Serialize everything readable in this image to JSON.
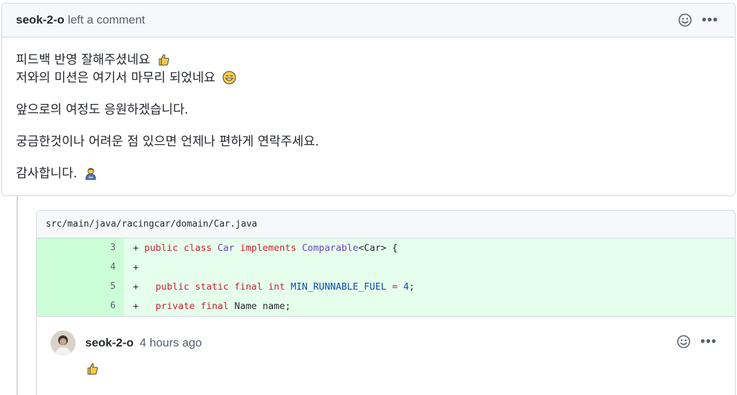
{
  "comment": {
    "author": "seok-2-o",
    "action": "left a comment",
    "paragraphs": [
      {
        "lines": [
          "피드백 반영 잘해주셨네요",
          "저와의 미션은 여기서 마무리 되었네요"
        ],
        "emojis": [
          "thumbs-up",
          "grinning-face"
        ]
      },
      {
        "text": "앞으로의 여정도 응원하겠습니다."
      },
      {
        "text": "궁금한것이나 어려운 점 있으면 언제나 편하게 연락주세요."
      },
      {
        "text": "감사합니다.",
        "emoji": "person-bowing"
      }
    ]
  },
  "thread": {
    "file_path": "src/main/java/racingcar/domain/Car.java",
    "diff": [
      {
        "line": "3",
        "code": "+ public class Car implements Comparable<Car> {"
      },
      {
        "line": "4",
        "code": "+"
      },
      {
        "line": "5",
        "code": "+   public static final int MIN_RUNNABLE_FUEL = 4;"
      },
      {
        "line": "6",
        "code": "+   private final Name name;"
      }
    ],
    "reply": {
      "author": "seok-2-o",
      "time": "4 hours ago",
      "emoji": "thumbs-up"
    }
  },
  "colors": {
    "border": "#d0d7de",
    "header_bg": "#f6f8fa",
    "diff_add_bg": "#e6ffec",
    "diff_num_bg": "#ccffd8",
    "keyword": "#cf222e",
    "type": "#6f42c1",
    "constant": "#0550ae"
  }
}
